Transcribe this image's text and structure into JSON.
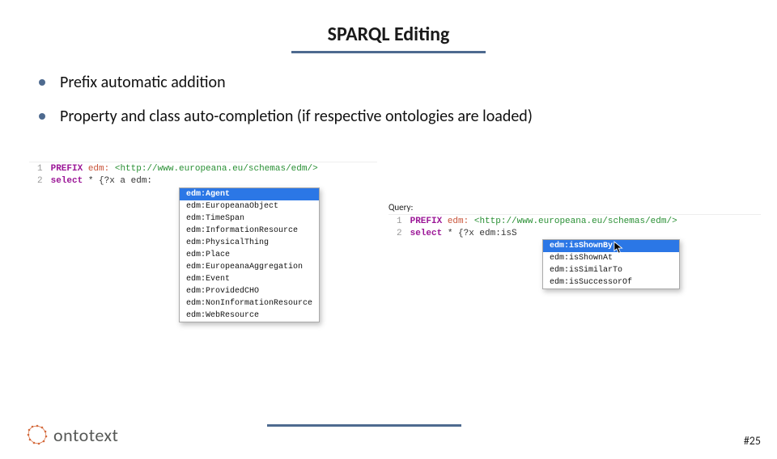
{
  "title": "SPARQL Editing",
  "bullets": [
    "Prefix automatic addition",
    "Property and class auto-completion (if respective ontologies are loaded)"
  ],
  "editor1": {
    "line1": {
      "kw": "PREFIX",
      "pfx": "edm:",
      "uri": "<http://www.europeana.eu/schemas/edm/>"
    },
    "line2": {
      "kw": "select",
      "rest": " * {?x a edm:"
    },
    "suggestions": [
      "edm:Agent",
      "edm:EuropeanaObject",
      "edm:TimeSpan",
      "edm:InformationResource",
      "edm:PhysicalThing",
      "edm:Place",
      "edm:EuropeanaAggregation",
      "edm:Event",
      "edm:ProvidedCHO",
      "edm:NonInformationResource",
      "edm:WebResource"
    ],
    "selected": 0
  },
  "editor2": {
    "label": "Query:",
    "line1": {
      "kw": "PREFIX",
      "pfx": "edm:",
      "uri": "<http://www.europeana.eu/schemas/edm/>"
    },
    "line2": {
      "kw": "select",
      "rest": " * {?x edm:isS"
    },
    "suggestions": [
      "edm:isShownBy",
      "edm:isShownAt",
      "edm:isSimilarTo",
      "edm:isSuccessorOf"
    ],
    "selected": 0
  },
  "logo": "ontotext",
  "page": "#25",
  "gutter": {
    "l1": "1",
    "l2": "2"
  }
}
